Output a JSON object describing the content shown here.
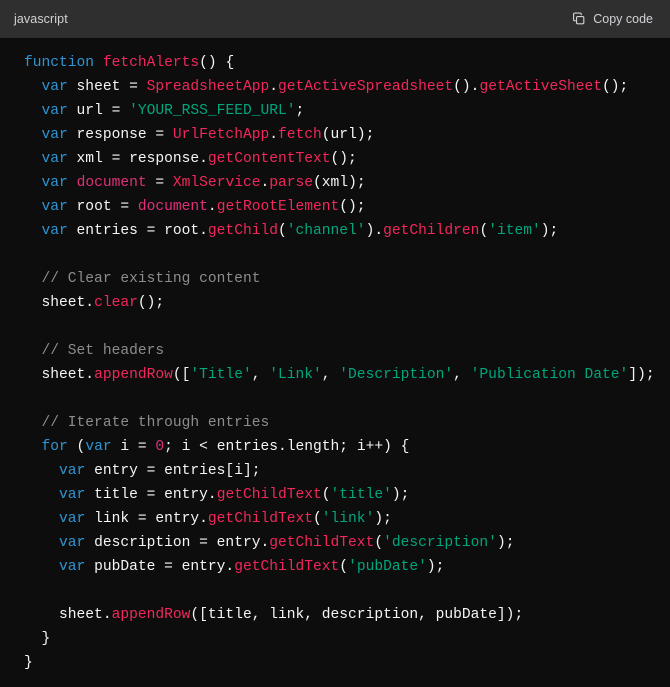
{
  "header": {
    "language_label": "javascript",
    "copy_label": "Copy code",
    "copy_icon": "copy-icon"
  },
  "theme": {
    "header_bg": "#2f2f2f",
    "code_bg": "#0d0d0d",
    "keyword": "#2e95d3",
    "function": "#f2275b",
    "string": "#00a67d",
    "comment": "#8c8c8c",
    "number": "#df3079",
    "builtin": "#df3079",
    "plain": "#f5f5f5"
  },
  "code": {
    "language": "javascript",
    "text": "function fetchAlerts() {\n  var sheet = SpreadsheetApp.getActiveSpreadsheet().getActiveSheet();\n  var url = 'YOUR_RSS_FEED_URL';\n  var response = UrlFetchApp.fetch(url);\n  var xml = response.getContentText();\n  var document = XmlService.parse(xml);\n  var root = document.getRootElement();\n  var entries = root.getChild('channel').getChildren('item');\n\n  // Clear existing content\n  sheet.clear();\n\n  // Set headers\n  sheet.appendRow(['Title', 'Link', 'Description', 'Publication Date']);\n\n  // Iterate through entries\n  for (var i = 0; i < entries.length; i++) {\n    var entry = entries[i];\n    var title = entry.getChildText('title');\n    var link = entry.getChildText('link');\n    var description = entry.getChildText('description');\n    var pubDate = entry.getChildText('pubDate');\n\n    sheet.appendRow([title, link, description, pubDate]);\n  }\n}",
    "lines": [
      {
        "n": 1,
        "tokens": [
          {
            "t": "function",
            "c": "kw"
          },
          {
            "t": " ",
            "c": "pl"
          },
          {
            "t": "fetchAlerts",
            "c": "fn"
          },
          {
            "t": "() {",
            "c": "punc"
          }
        ]
      },
      {
        "n": 2,
        "tokens": [
          {
            "t": "  ",
            "c": "pl"
          },
          {
            "t": "var",
            "c": "kw"
          },
          {
            "t": " sheet = ",
            "c": "pl"
          },
          {
            "t": "SpreadsheetApp",
            "c": "fn"
          },
          {
            "t": ".",
            "c": "punc"
          },
          {
            "t": "getActiveSpreadsheet",
            "c": "fn"
          },
          {
            "t": "().",
            "c": "punc"
          },
          {
            "t": "getActiveSheet",
            "c": "fn"
          },
          {
            "t": "();",
            "c": "punc"
          }
        ]
      },
      {
        "n": 3,
        "tokens": [
          {
            "t": "  ",
            "c": "pl"
          },
          {
            "t": "var",
            "c": "kw"
          },
          {
            "t": " url = ",
            "c": "pl"
          },
          {
            "t": "'YOUR_RSS_FEED_URL'",
            "c": "str"
          },
          {
            "t": ";",
            "c": "punc"
          }
        ]
      },
      {
        "n": 4,
        "tokens": [
          {
            "t": "  ",
            "c": "pl"
          },
          {
            "t": "var",
            "c": "kw"
          },
          {
            "t": " response = ",
            "c": "pl"
          },
          {
            "t": "UrlFetchApp",
            "c": "fn"
          },
          {
            "t": ".",
            "c": "punc"
          },
          {
            "t": "fetch",
            "c": "fn"
          },
          {
            "t": "(url);",
            "c": "punc"
          }
        ]
      },
      {
        "n": 5,
        "tokens": [
          {
            "t": "  ",
            "c": "pl"
          },
          {
            "t": "var",
            "c": "kw"
          },
          {
            "t": " xml = response.",
            "c": "pl"
          },
          {
            "t": "getContentText",
            "c": "fn"
          },
          {
            "t": "();",
            "c": "punc"
          }
        ]
      },
      {
        "n": 6,
        "tokens": [
          {
            "t": "  ",
            "c": "pl"
          },
          {
            "t": "var",
            "c": "kw"
          },
          {
            "t": " ",
            "c": "pl"
          },
          {
            "t": "document",
            "c": "bi"
          },
          {
            "t": " = ",
            "c": "pl"
          },
          {
            "t": "XmlService",
            "c": "fn"
          },
          {
            "t": ".",
            "c": "punc"
          },
          {
            "t": "parse",
            "c": "fn"
          },
          {
            "t": "(xml);",
            "c": "punc"
          }
        ]
      },
      {
        "n": 7,
        "tokens": [
          {
            "t": "  ",
            "c": "pl"
          },
          {
            "t": "var",
            "c": "kw"
          },
          {
            "t": " root = ",
            "c": "pl"
          },
          {
            "t": "document",
            "c": "bi"
          },
          {
            "t": ".",
            "c": "punc"
          },
          {
            "t": "getRootElement",
            "c": "fn"
          },
          {
            "t": "();",
            "c": "punc"
          }
        ]
      },
      {
        "n": 8,
        "tokens": [
          {
            "t": "  ",
            "c": "pl"
          },
          {
            "t": "var",
            "c": "kw"
          },
          {
            "t": " entries = root.",
            "c": "pl"
          },
          {
            "t": "getChild",
            "c": "fn"
          },
          {
            "t": "(",
            "c": "punc"
          },
          {
            "t": "'channel'",
            "c": "str"
          },
          {
            "t": ").",
            "c": "punc"
          },
          {
            "t": "getChildren",
            "c": "fn"
          },
          {
            "t": "(",
            "c": "punc"
          },
          {
            "t": "'item'",
            "c": "str"
          },
          {
            "t": ");",
            "c": "punc"
          }
        ]
      },
      {
        "n": 9,
        "tokens": [
          {
            "t": "",
            "c": "pl"
          }
        ]
      },
      {
        "n": 10,
        "tokens": [
          {
            "t": "  ",
            "c": "pl"
          },
          {
            "t": "// Clear existing content",
            "c": "com"
          }
        ]
      },
      {
        "n": 11,
        "tokens": [
          {
            "t": "  sheet.",
            "c": "pl"
          },
          {
            "t": "clear",
            "c": "fn"
          },
          {
            "t": "();",
            "c": "punc"
          }
        ]
      },
      {
        "n": 12,
        "tokens": [
          {
            "t": "",
            "c": "pl"
          }
        ]
      },
      {
        "n": 13,
        "tokens": [
          {
            "t": "  ",
            "c": "pl"
          },
          {
            "t": "// Set headers",
            "c": "com"
          }
        ]
      },
      {
        "n": 14,
        "tokens": [
          {
            "t": "  sheet.",
            "c": "pl"
          },
          {
            "t": "appendRow",
            "c": "fn"
          },
          {
            "t": "([",
            "c": "punc"
          },
          {
            "t": "'Title'",
            "c": "str"
          },
          {
            "t": ", ",
            "c": "punc"
          },
          {
            "t": "'Link'",
            "c": "str"
          },
          {
            "t": ", ",
            "c": "punc"
          },
          {
            "t": "'Description'",
            "c": "str"
          },
          {
            "t": ", ",
            "c": "punc"
          },
          {
            "t": "'Publication Date'",
            "c": "str"
          },
          {
            "t": "]);",
            "c": "punc"
          }
        ]
      },
      {
        "n": 15,
        "tokens": [
          {
            "t": "",
            "c": "pl"
          }
        ]
      },
      {
        "n": 16,
        "tokens": [
          {
            "t": "  ",
            "c": "pl"
          },
          {
            "t": "// Iterate through entries",
            "c": "com"
          }
        ]
      },
      {
        "n": 17,
        "tokens": [
          {
            "t": "  ",
            "c": "pl"
          },
          {
            "t": "for",
            "c": "kw"
          },
          {
            "t": " (",
            "c": "punc"
          },
          {
            "t": "var",
            "c": "kw"
          },
          {
            "t": " i = ",
            "c": "pl"
          },
          {
            "t": "0",
            "c": "num"
          },
          {
            "t": "; i < entries.length; i++) {",
            "c": "punc"
          }
        ]
      },
      {
        "n": 18,
        "tokens": [
          {
            "t": "    ",
            "c": "pl"
          },
          {
            "t": "var",
            "c": "kw"
          },
          {
            "t": " entry = entries[i];",
            "c": "pl"
          }
        ]
      },
      {
        "n": 19,
        "tokens": [
          {
            "t": "    ",
            "c": "pl"
          },
          {
            "t": "var",
            "c": "kw"
          },
          {
            "t": " title = entry.",
            "c": "pl"
          },
          {
            "t": "getChildText",
            "c": "fn"
          },
          {
            "t": "(",
            "c": "punc"
          },
          {
            "t": "'title'",
            "c": "str"
          },
          {
            "t": ");",
            "c": "punc"
          }
        ]
      },
      {
        "n": 20,
        "tokens": [
          {
            "t": "    ",
            "c": "pl"
          },
          {
            "t": "var",
            "c": "kw"
          },
          {
            "t": " link = entry.",
            "c": "pl"
          },
          {
            "t": "getChildText",
            "c": "fn"
          },
          {
            "t": "(",
            "c": "punc"
          },
          {
            "t": "'link'",
            "c": "str"
          },
          {
            "t": ");",
            "c": "punc"
          }
        ]
      },
      {
        "n": 21,
        "tokens": [
          {
            "t": "    ",
            "c": "pl"
          },
          {
            "t": "var",
            "c": "kw"
          },
          {
            "t": " description = entry.",
            "c": "pl"
          },
          {
            "t": "getChildText",
            "c": "fn"
          },
          {
            "t": "(",
            "c": "punc"
          },
          {
            "t": "'description'",
            "c": "str"
          },
          {
            "t": ");",
            "c": "punc"
          }
        ]
      },
      {
        "n": 22,
        "tokens": [
          {
            "t": "    ",
            "c": "pl"
          },
          {
            "t": "var",
            "c": "kw"
          },
          {
            "t": " pubDate = entry.",
            "c": "pl"
          },
          {
            "t": "getChildText",
            "c": "fn"
          },
          {
            "t": "(",
            "c": "punc"
          },
          {
            "t": "'pubDate'",
            "c": "str"
          },
          {
            "t": ");",
            "c": "punc"
          }
        ]
      },
      {
        "n": 23,
        "tokens": [
          {
            "t": "",
            "c": "pl"
          }
        ]
      },
      {
        "n": 24,
        "tokens": [
          {
            "t": "    sheet.",
            "c": "pl"
          },
          {
            "t": "appendRow",
            "c": "fn"
          },
          {
            "t": "([title, link, description, pubDate]);",
            "c": "punc"
          }
        ]
      },
      {
        "n": 25,
        "tokens": [
          {
            "t": "  }",
            "c": "punc"
          }
        ]
      },
      {
        "n": 26,
        "tokens": [
          {
            "t": "}",
            "c": "punc"
          }
        ]
      }
    ]
  }
}
